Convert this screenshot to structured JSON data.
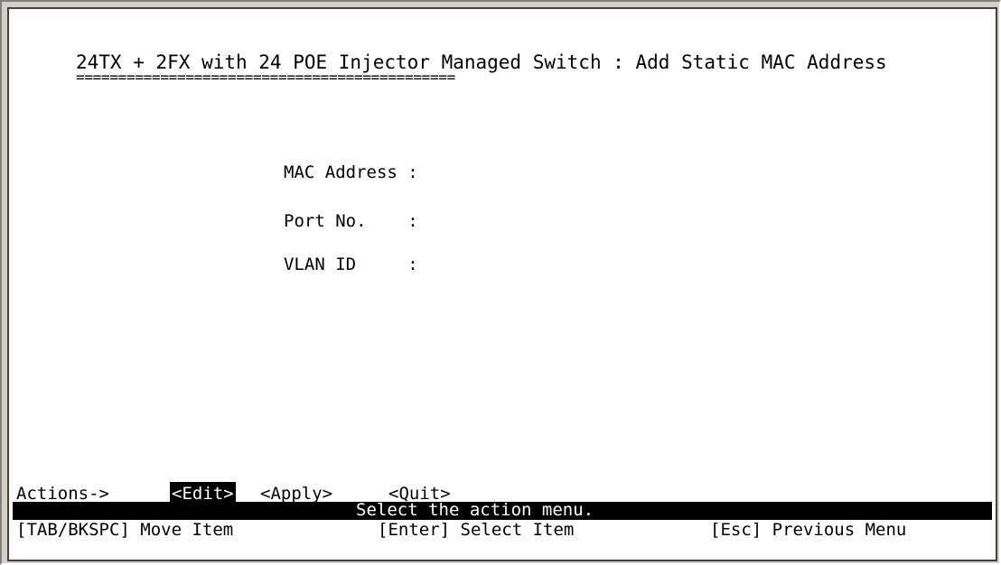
{
  "title": "24TX + 2FX with 24 POE Injector Managed Switch : Add Static MAC Address",
  "title_underline": "=============================================",
  "fields": {
    "mac_address": "MAC Address :",
    "port_no": "Port No.    :",
    "vlan_id": "VLAN ID     :"
  },
  "actions": {
    "label": "Actions->",
    "edit": "<Edit>",
    "apply": "<Apply>",
    "quit": "<Quit>"
  },
  "status": "Select the action menu.",
  "hints": {
    "tab": "[TAB/BKSPC] Move Item",
    "enter": "[Enter] Select Item",
    "esc": "[Esc] Previous Menu"
  }
}
